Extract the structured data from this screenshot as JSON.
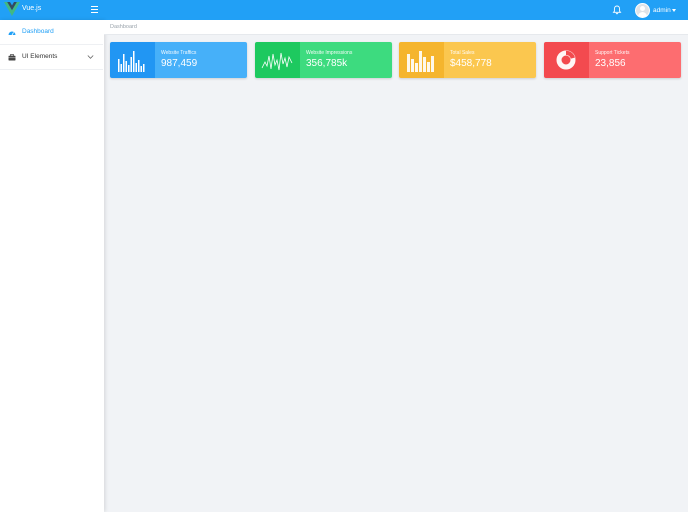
{
  "header": {
    "brand": "Vue.js",
    "user_name": "admin",
    "colors": {
      "bar": "#21a0f6"
    }
  },
  "sidebar": {
    "items": [
      {
        "label": "Dashboard",
        "icon": "dashboard-icon",
        "active": true
      },
      {
        "label": "UI Elements",
        "icon": "briefcase-icon",
        "expandable": true
      }
    ]
  },
  "breadcrumb": {
    "current": "Dashboard"
  },
  "cards": [
    {
      "title": "Website Traffics",
      "value": "987,459",
      "icon": "bar-chart-icon",
      "color": "#2196f3"
    },
    {
      "title": "Website Impressions",
      "value": "356,785k",
      "icon": "line-chart-icon",
      "color": "#1dc95f"
    },
    {
      "title": "Total Sales",
      "value": "$458,778",
      "icon": "bar-chart-icon",
      "color": "#f5b52d"
    },
    {
      "title": "Support Tickets",
      "value": "23,856",
      "icon": "donut-chart-icon",
      "color": "#f34a4f"
    }
  ]
}
